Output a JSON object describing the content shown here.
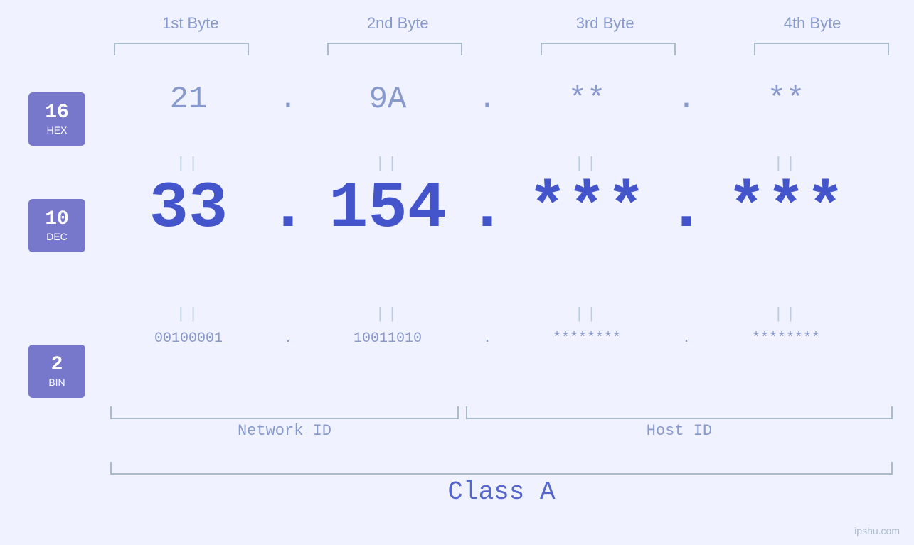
{
  "page": {
    "background": "#f0f2ff",
    "watermark": "ipshu.com"
  },
  "byteHeaders": [
    "1st Byte",
    "2nd Byte",
    "3rd Byte",
    "4th Byte"
  ],
  "badges": [
    {
      "id": "hex",
      "num": "16",
      "label": "HEX"
    },
    {
      "id": "dec",
      "num": "10",
      "label": "DEC"
    },
    {
      "id": "bin",
      "num": "2",
      "label": "BIN"
    }
  ],
  "hexRow": {
    "values": [
      "21",
      "9A",
      "**",
      "**"
    ],
    "dots": [
      ".",
      ".",
      ".",
      ""
    ]
  },
  "decRow": {
    "values": [
      "33",
      "154",
      "***",
      "***"
    ],
    "dots": [
      ".",
      ".",
      ".",
      ""
    ]
  },
  "binRow": {
    "values": [
      "00100001",
      "10011010",
      "********",
      "********"
    ],
    "dots": [
      ".",
      ".",
      ".",
      ""
    ]
  },
  "labels": {
    "networkId": "Network ID",
    "hostId": "Host ID"
  },
  "classLabel": "Class A",
  "separatorChar": "||"
}
